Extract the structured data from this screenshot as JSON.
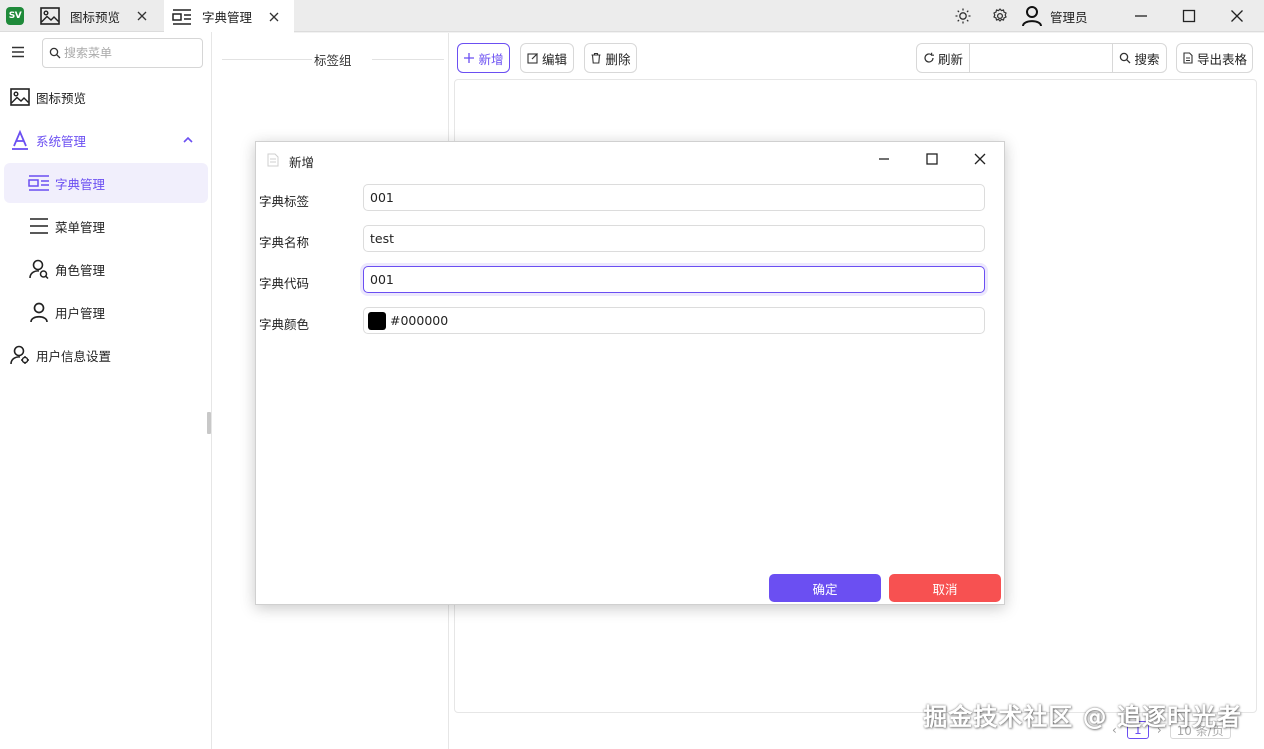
{
  "app": {
    "logo_text": "SV"
  },
  "tabs": [
    {
      "label": "图标预览",
      "icon": "image-icon"
    },
    {
      "label": "字典管理",
      "icon": "dictionary-icon",
      "active": true
    }
  ],
  "header": {
    "user_name": "管理员",
    "icons": [
      "theme-sun-icon",
      "settings-gear-icon",
      "user-icon",
      "minimize-icon",
      "maximize-icon",
      "close-icon"
    ]
  },
  "sidebar": {
    "search_placeholder": "搜索菜单",
    "items": [
      {
        "label": "图标预览",
        "icon": "image-icon"
      },
      {
        "label": "系统管理",
        "icon": "letter-a-icon",
        "expanded": true
      },
      {
        "label": "字典管理",
        "icon": "dictionary-icon",
        "active": true
      },
      {
        "label": "菜单管理",
        "icon": "menu-lines-icon"
      },
      {
        "label": "角色管理",
        "icon": "role-icon"
      },
      {
        "label": "用户管理",
        "icon": "user-icon"
      },
      {
        "label": "用户信息设置",
        "icon": "user-settings-icon"
      }
    ]
  },
  "tag_panel": {
    "title": "标签组"
  },
  "toolbar": {
    "add_label": "新增",
    "edit_label": "编辑",
    "delete_label": "删除",
    "refresh_label": "刷新",
    "search_value": "",
    "search_label": "搜索",
    "export_label": "导出表格"
  },
  "pagination": {
    "current_page": "1",
    "page_size": "10 条/页"
  },
  "watermark": "掘金技术社区 @ 追逐时光者",
  "dialog": {
    "title": "新增",
    "fields": [
      {
        "label": "字典标签",
        "value": "001"
      },
      {
        "label": "字典名称",
        "value": "test"
      },
      {
        "label": "字典代码",
        "value": "001",
        "focused": true
      },
      {
        "label": "字典颜色",
        "value": "#000000"
      }
    ],
    "confirm_label": "确定",
    "cancel_label": "取消"
  },
  "colors": {
    "accent": "#6b4ff2",
    "confirm": "#6b4ff2",
    "cancel": "#f75151",
    "dict_color_swatch": "#000000",
    "logo_bg": "#1f8a3a"
  }
}
